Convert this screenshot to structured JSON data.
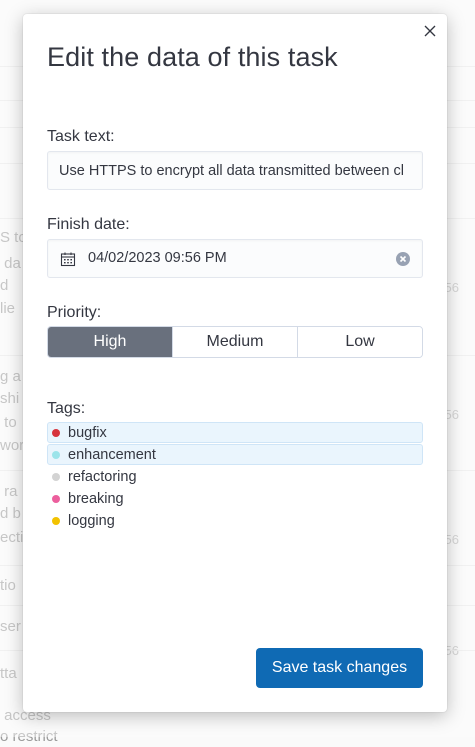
{
  "background": {
    "rows": [
      {
        "text": "S to",
        "num": ""
      },
      {
        "text": " da",
        "num": ""
      },
      {
        "text": "d",
        "num": "56"
      },
      {
        "text": "lie",
        "num": ""
      },
      {
        "text": "g a",
        "num": ""
      },
      {
        "text": "shi",
        "num": ""
      },
      {
        "text": " to",
        "num": "56"
      },
      {
        "text": "wor",
        "num": ""
      },
      {
        "text": " ra",
        "num": ""
      },
      {
        "text": "d b",
        "num": ""
      },
      {
        "text": "ecti",
        "num": "56"
      },
      {
        "text": "tio",
        "num": ""
      },
      {
        "text": "ser",
        "num": "56"
      },
      {
        "text": "tta",
        "num": ""
      },
      {
        "text": " access",
        "num": ""
      },
      {
        "text": "o restrict",
        "num": ""
      }
    ]
  },
  "modal": {
    "title": "Edit the data of this task",
    "close_icon": "close-icon",
    "task_text": {
      "label": "Task text:",
      "value": "Use HTTPS to encrypt all data transmitted between cl"
    },
    "finish_date": {
      "label": "Finish date:",
      "value": "04/02/2023 09:56 PM",
      "icon": "calendar-icon",
      "clear_icon": "clear-icon"
    },
    "priority": {
      "label": "Priority:",
      "options": [
        "High",
        "Medium",
        "Low"
      ],
      "selected": "High"
    },
    "tags": {
      "label": "Tags:",
      "items": [
        {
          "label": "bugfix",
          "color": "#d6333c",
          "selected": true
        },
        {
          "label": "enhancement",
          "color": "#9ce4ea",
          "selected": true
        },
        {
          "label": "refactoring",
          "color": "#d3d3d3",
          "selected": false
        },
        {
          "label": "breaking",
          "color": "#ec5f9d",
          "selected": false
        },
        {
          "label": "logging",
          "color": "#f2c200",
          "selected": false
        }
      ]
    },
    "save_label": "Save task changes"
  },
  "colors": {
    "accent": "#0f6ab4",
    "priority_active": "#69707d",
    "tag_selected_bg": "#eaf5fd"
  }
}
